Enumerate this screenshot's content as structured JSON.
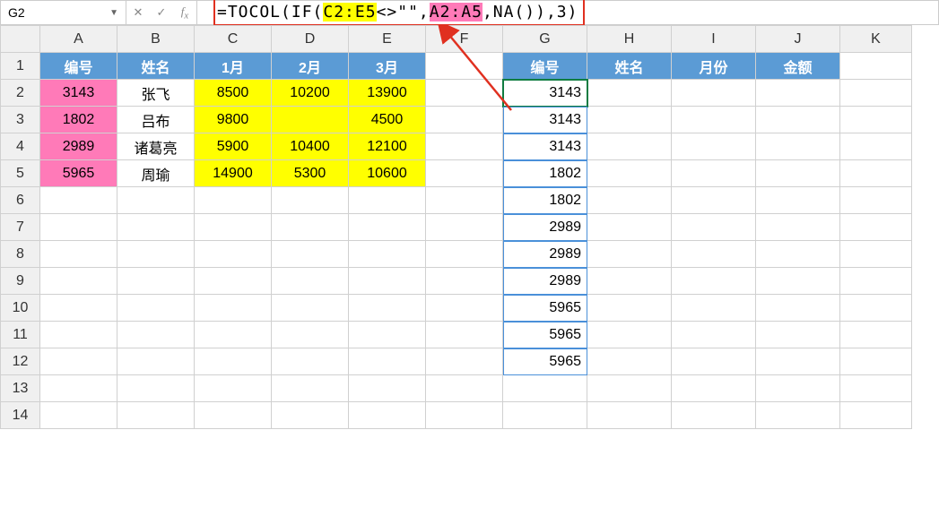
{
  "nameBox": "G2",
  "formula": {
    "prefix": "=TOCOL(IF(",
    "rangeYellow": "C2:E5",
    "mid1": "<>\"\",",
    "rangePink": "A2:A5",
    "suffix": ",NA()),3)"
  },
  "colHeaders": [
    "A",
    "B",
    "C",
    "D",
    "E",
    "F",
    "G",
    "H",
    "I",
    "J",
    "K"
  ],
  "rowHeaders": [
    "1",
    "2",
    "3",
    "4",
    "5",
    "6",
    "7",
    "8",
    "9",
    "10",
    "11",
    "12",
    "13",
    "14"
  ],
  "leftHeader": [
    "编号",
    "姓名",
    "1月",
    "2月",
    "3月"
  ],
  "leftData": [
    {
      "id": "3143",
      "name": "张飞",
      "m1": "8500",
      "m2": "10200",
      "m3": "13900"
    },
    {
      "id": "1802",
      "name": "吕布",
      "m1": "9800",
      "m2": "",
      "m3": "4500"
    },
    {
      "id": "2989",
      "name": "诸葛亮",
      "m1": "5900",
      "m2": "10400",
      "m3": "12100"
    },
    {
      "id": "5965",
      "name": "周瑜",
      "m1": "14900",
      "m2": "5300",
      "m3": "10600"
    }
  ],
  "rightHeader": [
    "编号",
    "姓名",
    "月份",
    "金额"
  ],
  "gCol": [
    "3143",
    "3143",
    "3143",
    "1802",
    "1802",
    "2989",
    "2989",
    "2989",
    "5965",
    "5965",
    "5965"
  ]
}
